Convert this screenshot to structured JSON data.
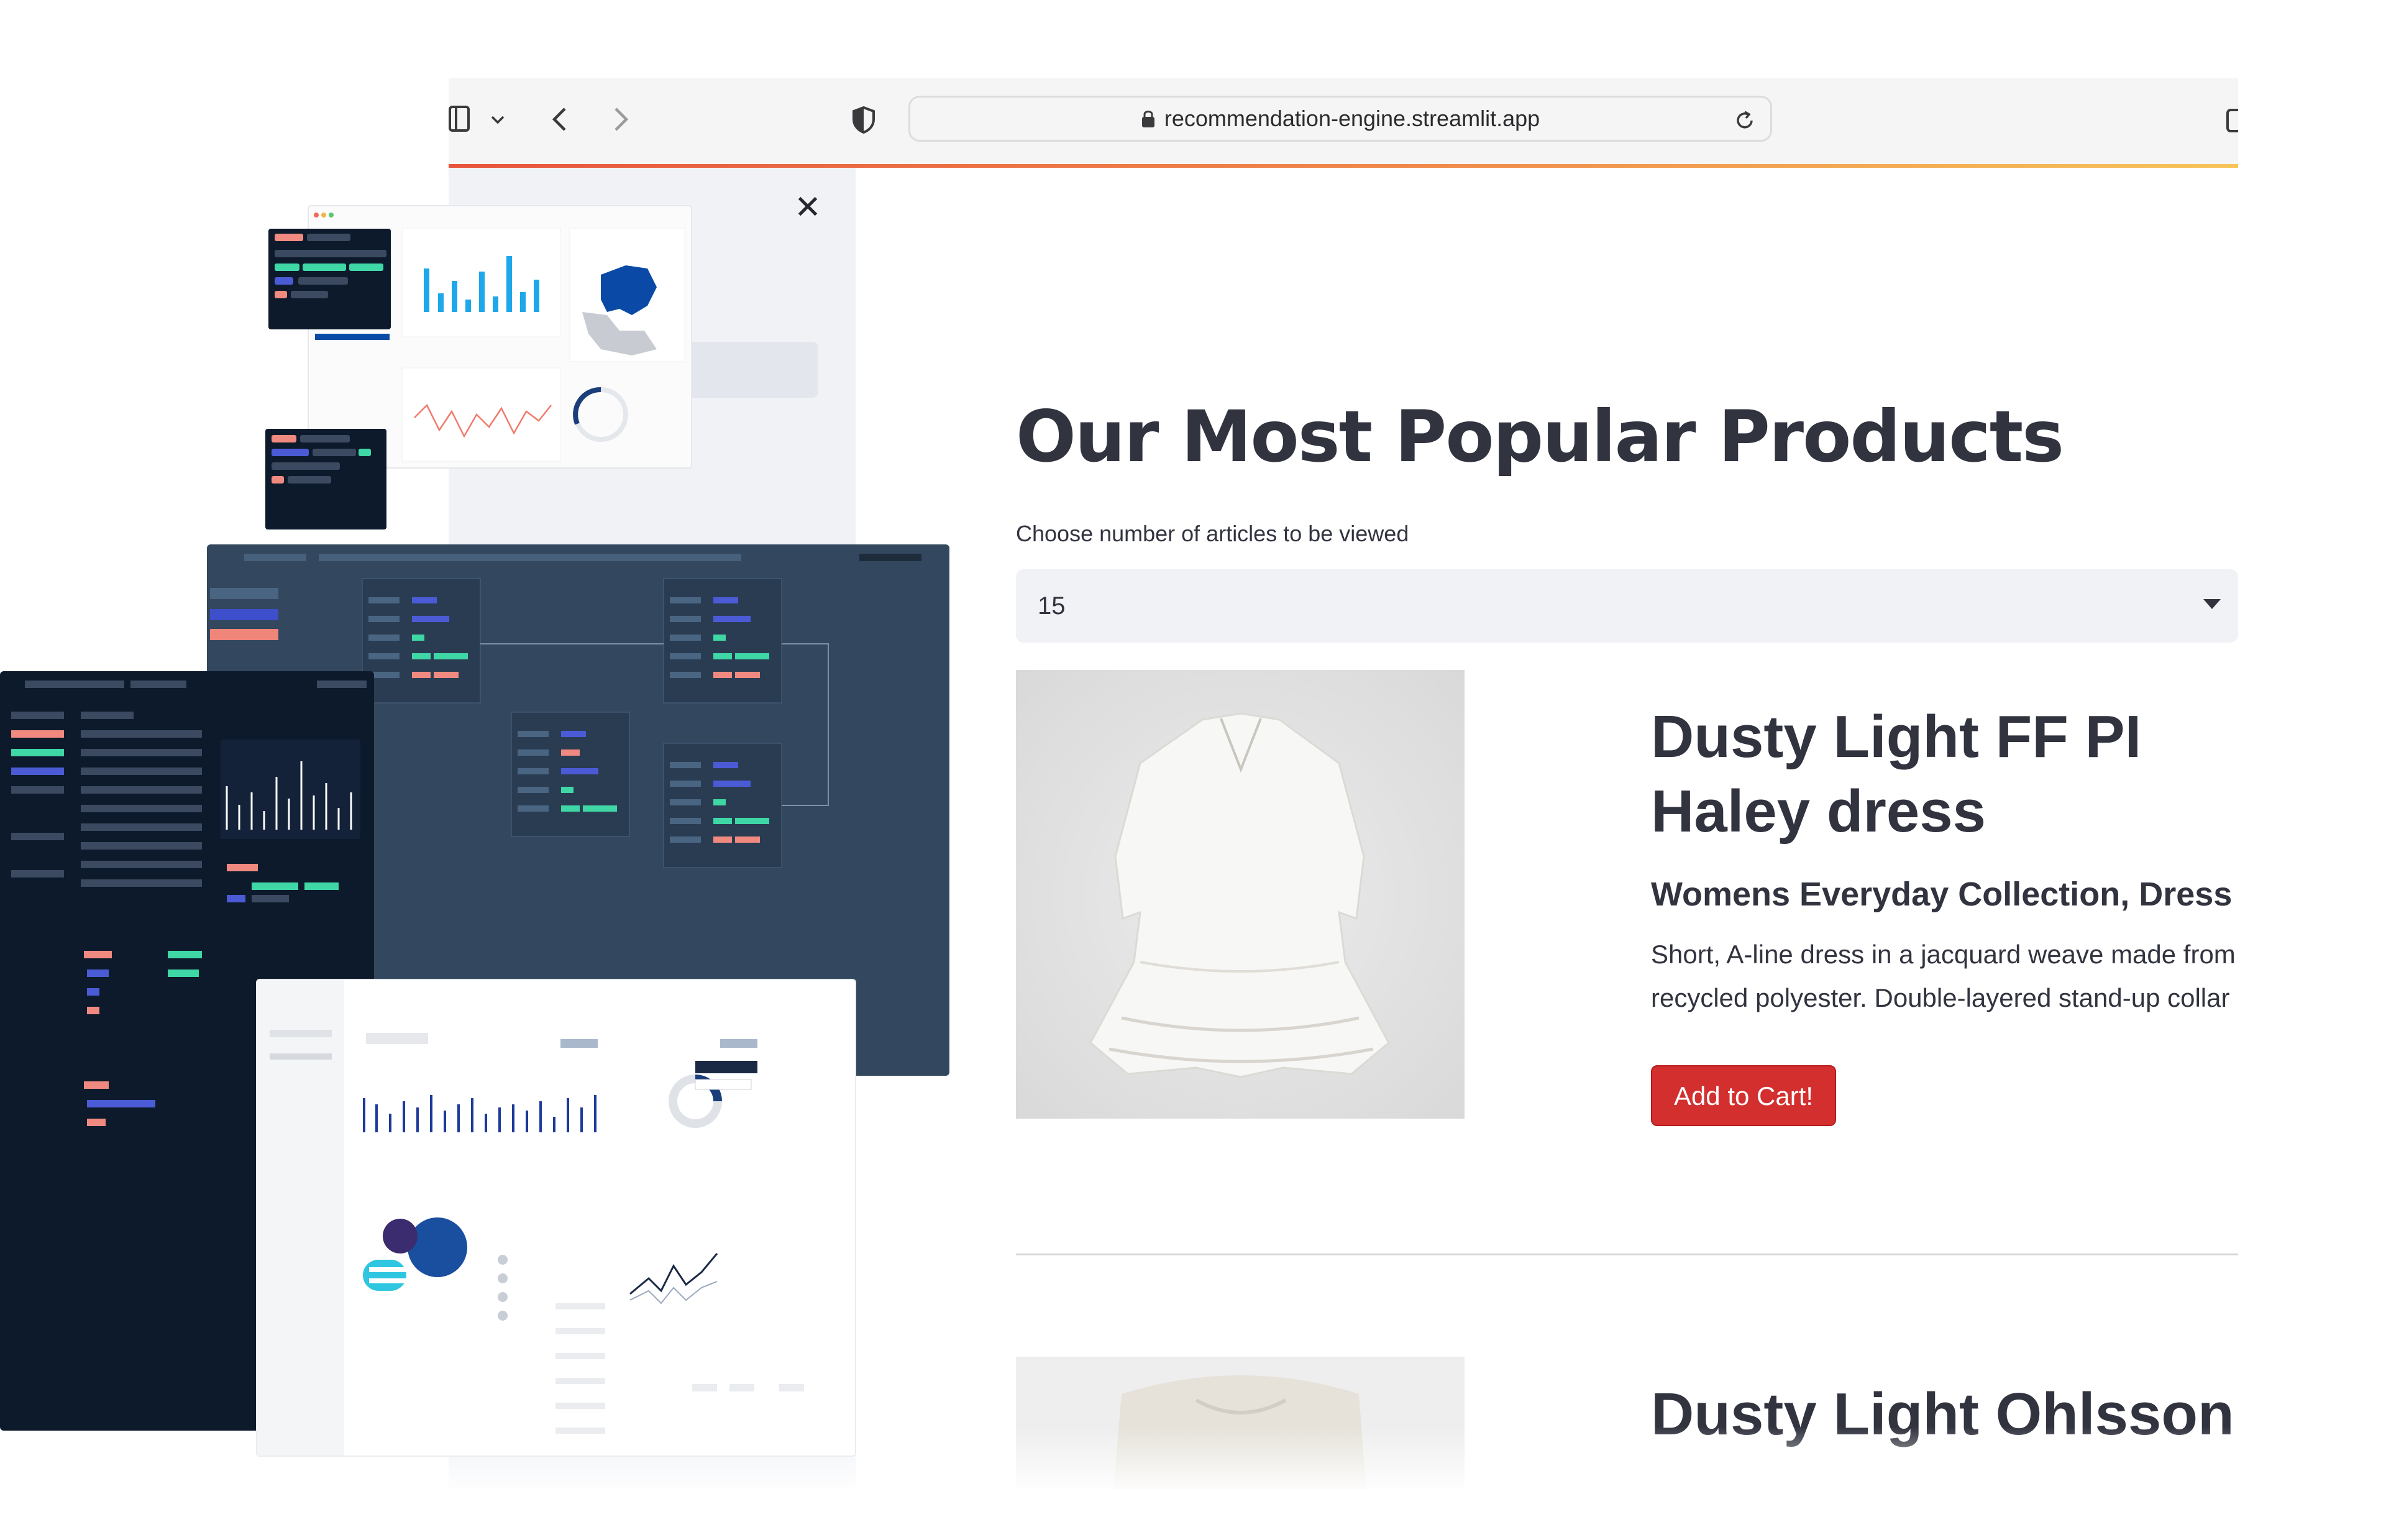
{
  "browser": {
    "url": "recommendation-engine.streamlit.app",
    "icons": [
      "sidebar-toggle-icon",
      "chevron-down-icon",
      "back-icon",
      "forward-icon",
      "shield-icon",
      "lock-icon",
      "reload-icon",
      "tabs-icon"
    ]
  },
  "sidebar": {
    "close_icon": "close-icon",
    "close_glyph": "✕"
  },
  "main": {
    "title": "Our Most Popular Products",
    "select": {
      "label": "Choose number of articles to be viewed",
      "value": "15"
    },
    "products": [
      {
        "name": "Dusty Light FF PI Haley dress",
        "category": "Womens Everyday Collection, Dress",
        "description": "Short, A-line dress in a jacquard weave made from recycled polyester. Double-layered stand-up collar",
        "button": "Add to Cart!"
      },
      {
        "name": "Dusty Light Ohlsson"
      }
    ]
  },
  "colors": {
    "accent_button": "#d32f2f",
    "text": "#31333f",
    "sidebar_bg": "#f0f2f6"
  }
}
